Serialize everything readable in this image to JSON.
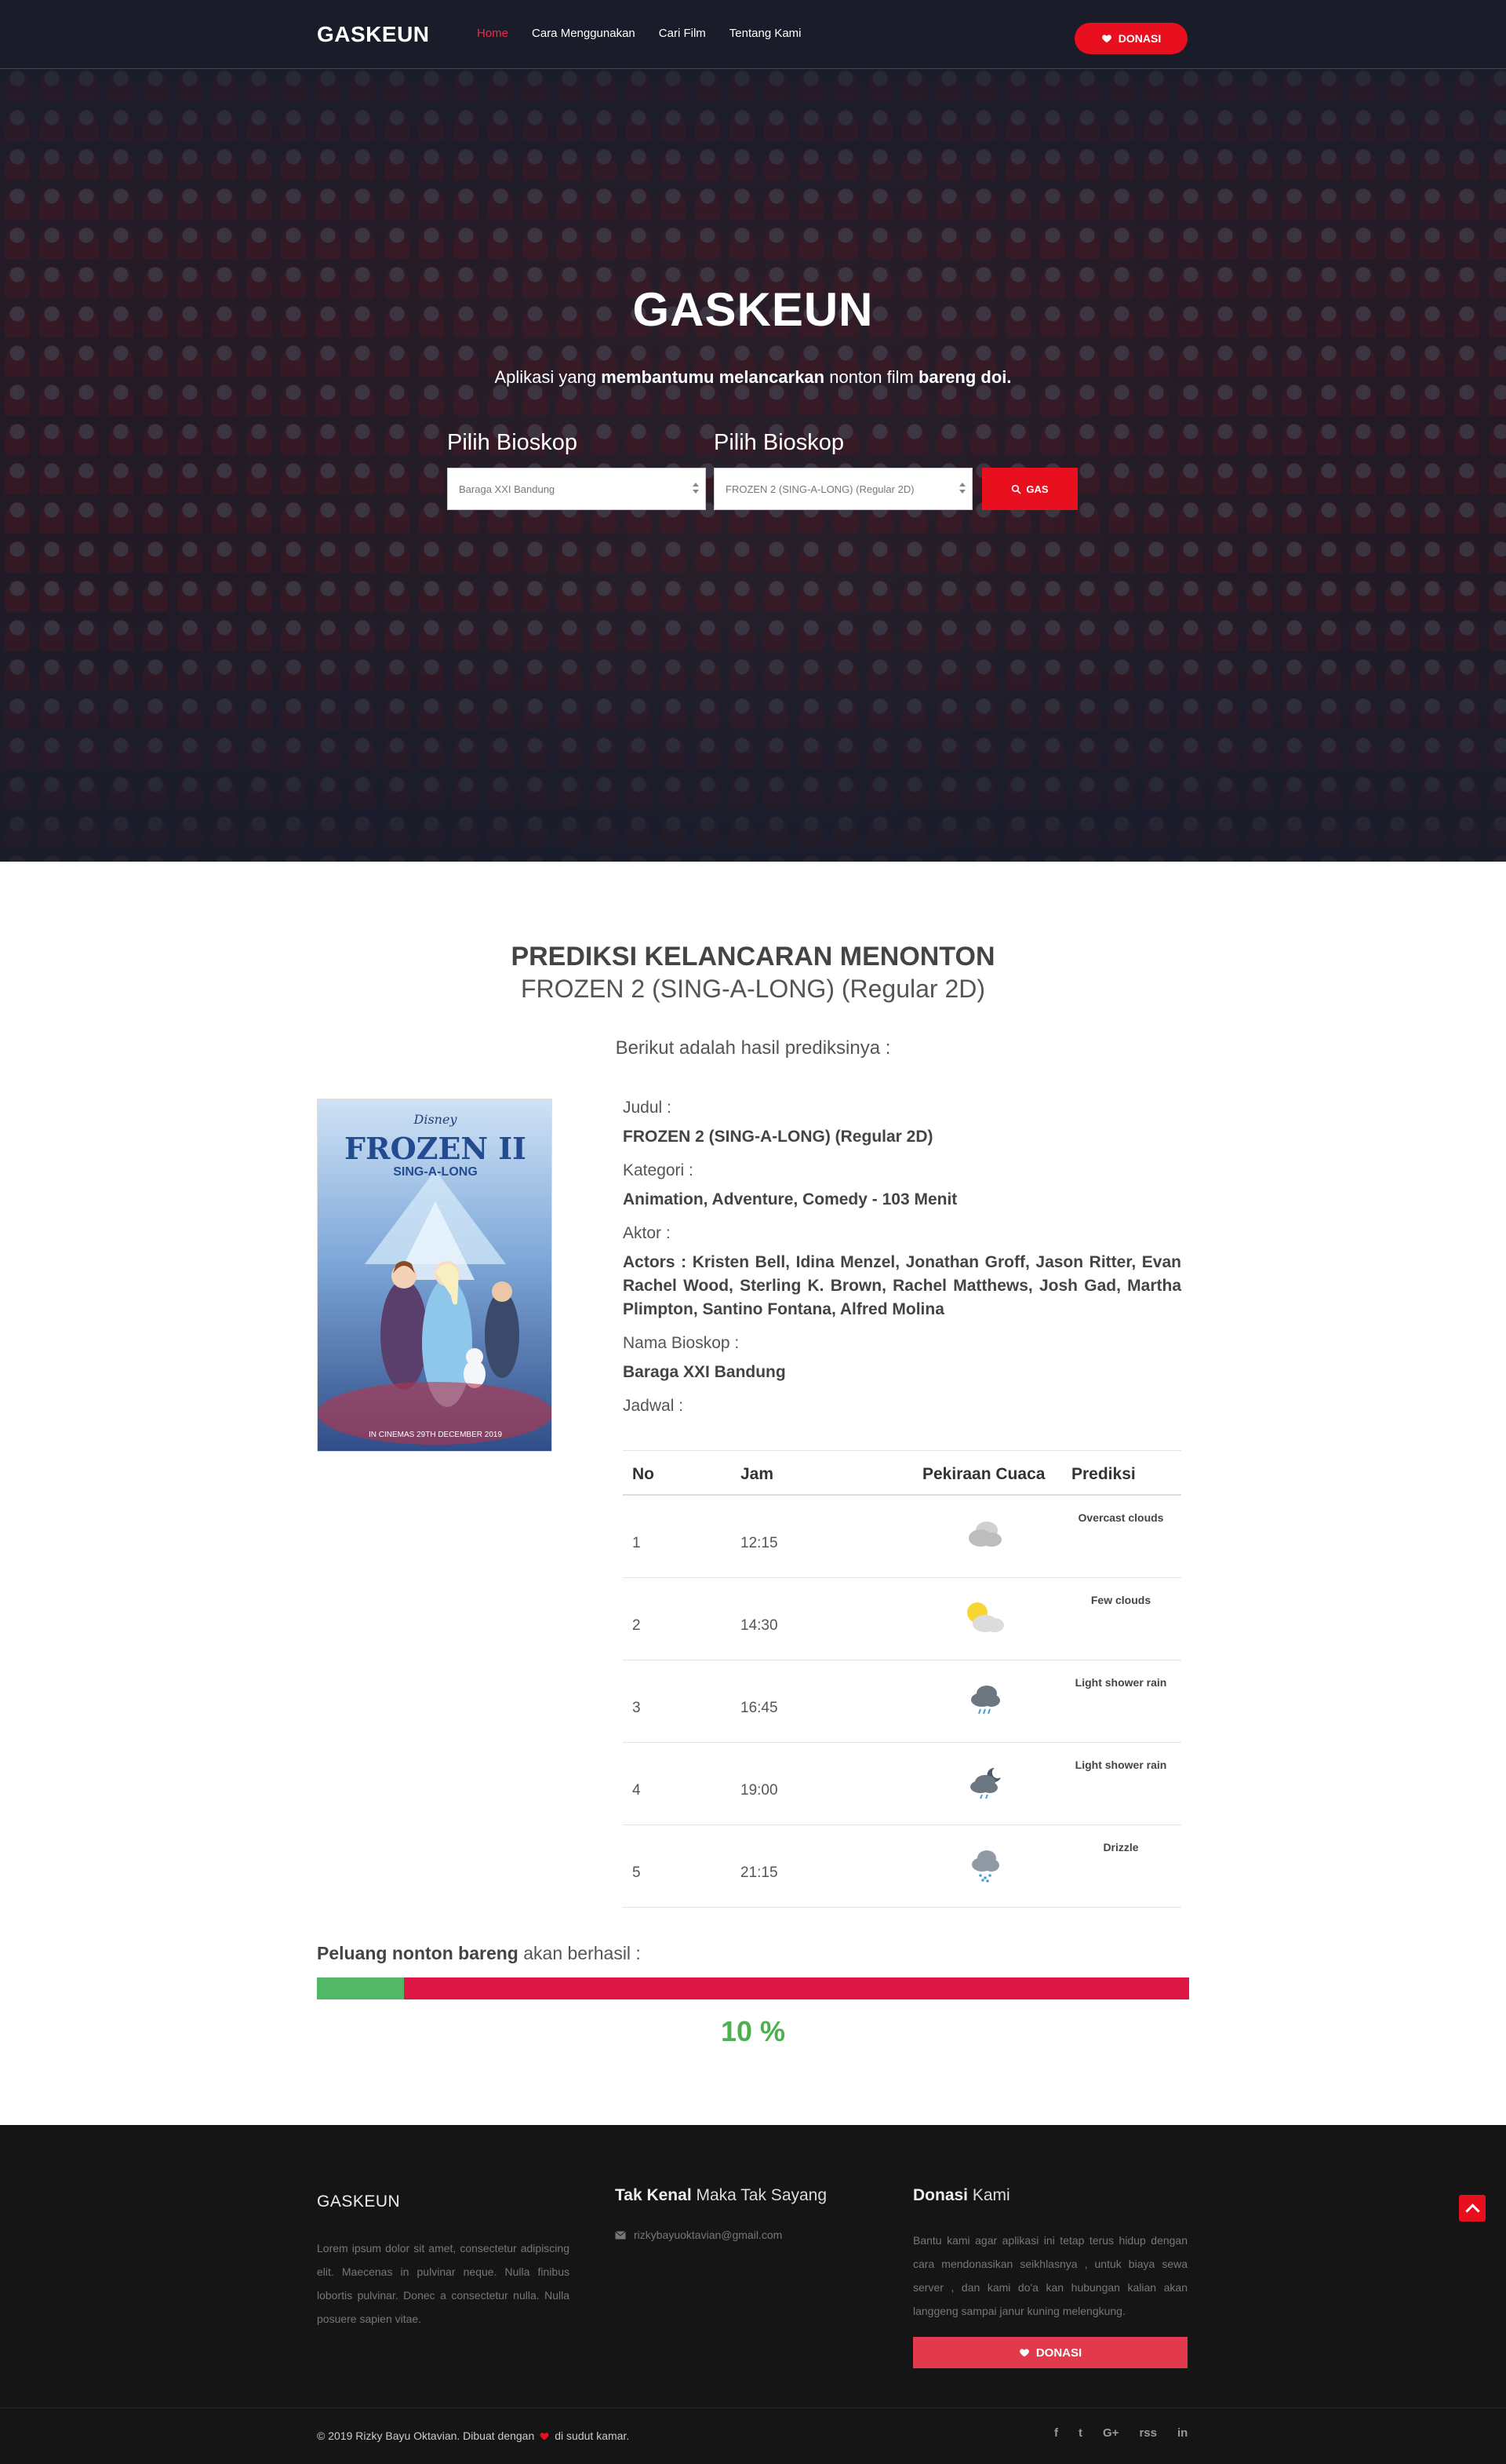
{
  "nav": {
    "brand": "GASKEUN",
    "links": [
      "Home",
      "Cara Menggunakan",
      "Cari Film",
      "Tentang Kami"
    ],
    "donasi_label": "DONASI"
  },
  "hero": {
    "title": "GASKEUN",
    "subtitle_pre": "Aplikasi yang ",
    "subtitle_bold1": "membantumu melancarkan",
    "subtitle_mid": " nonton film ",
    "subtitle_bold2": "bareng doi.",
    "field1_label": "Pilih Bioskop",
    "field1_value": "Baraga XXI Bandung",
    "field2_label": "Pilih Bioskop",
    "field2_value": "FROZEN 2 (SING-A-LONG) (Regular 2D)",
    "gas_label": "GAS"
  },
  "prediction": {
    "title": "PREDIKSI KELANCARAN MENONTON",
    "movie": "FROZEN 2 (SING-A-LONG) (Regular 2D)",
    "desc": "Berikut adalah hasil prediksinya :",
    "poster": {
      "brand": "Disney",
      "title": "FROZEN II",
      "subtitle": "SING-A-LONG",
      "footer": "IN CINEMAS 29TH DECEMBER 2019"
    },
    "judul_label": "Judul :",
    "judul": "FROZEN 2 (SING-A-LONG) (Regular 2D)",
    "kategori_label": "Kategori :",
    "kategori": "Animation, Adventure, Comedy - 103 Menit",
    "aktor_label": "Aktor :",
    "aktor": "Actors : Kristen Bell, Idina Menzel, Jonathan Groff, Jason Ritter, Evan Rachel Wood, Sterling K. Brown, Rachel Matthews, Josh Gad, Martha Plimpton, Santino Fontana, Alfred Molina",
    "bioskop_label": "Nama Bioskop :",
    "bioskop": "Baraga XXI Bandung",
    "jadwal_label": "Jadwal :",
    "table": {
      "headers": [
        "No",
        "Jam",
        "Pekiraan Cuaca",
        "Prediksi"
      ],
      "rows": [
        {
          "no": "1",
          "jam": "12:15",
          "weather_icon": "overcast-cloud-icon",
          "prediksi": "Overcast clouds"
        },
        {
          "no": "2",
          "jam": "14:30",
          "weather_icon": "sun-cloud-icon",
          "prediksi": "Few clouds"
        },
        {
          "no": "3",
          "jam": "16:45",
          "weather_icon": "rain-cloud-icon",
          "prediksi": "Light shower rain"
        },
        {
          "no": "4",
          "jam": "19:00",
          "weather_icon": "moon-cloud-icon",
          "prediksi": "Light shower rain"
        },
        {
          "no": "5",
          "jam": "21:15",
          "weather_icon": "drizzle-cloud-icon",
          "prediksi": "Drizzle"
        }
      ]
    },
    "chance_bold": "Peluang nonton bareng",
    "chance_rest": " akan berhasil :",
    "chance_fraction": 0.1,
    "chance_value": "10 %"
  },
  "footer": {
    "brand": "GASKEUN",
    "lorem": "Lorem ipsum dolor sit amet, consectetur adipiscing elit. Maecenas in pulvinar neque. Nulla finibus lobortis pulvinar. Donec a consectetur nulla. Nulla posuere sapien vitae.",
    "col2_bold": "Tak Kenal",
    "col2_rest": " Maka Tak Sayang",
    "email": "rizkybayuoktavian@gmail.com",
    "col3_bold": "Donasi",
    "col3_rest": " Kami",
    "donasi_text": "Bantu kami agar aplikasi ini tetap terus hidup dengan cara mendonasikan seikhlasnya , untuk biaya sewa server , dan kami do'a kan hubungan kalian akan langgeng sampai janur kuning melengkung.",
    "donasi_btn": "DONASI",
    "copy_pre": "© 2019 Rizky Bayu Oktavian. Dibuat dengan",
    "copy_post": "di sudut kamar.",
    "social": [
      "f",
      "t",
      "G+",
      "rss",
      "in"
    ]
  },
  "colors": {
    "accent": "#e8101f",
    "success": "#52b766",
    "danger_bar": "#dd1646"
  }
}
